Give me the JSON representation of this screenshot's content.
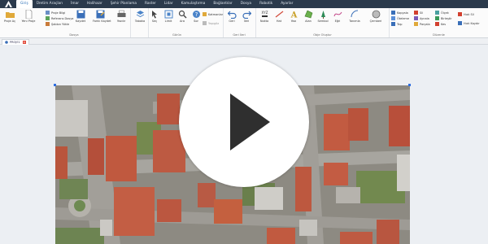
{
  "menu": {
    "items": [
      "Giriş",
      "Üretim Araçları",
      "İmar",
      "Halihazır",
      "Şehir Planlama",
      "Raster",
      "Lidar",
      "Kamulaştırma",
      "Bağlantılar",
      "Dosya",
      "Robotik",
      "Ayarlar"
    ],
    "active": "Giriş"
  },
  "ribbon": {
    "groups": {
      "dosya": "Dosya",
      "gorun": "Görün",
      "geri_ileri": "Geri İleri",
      "obje_olustur": "Obje Oluştur",
      "duzenle": "Düzenle"
    },
    "dosya": {
      "proje_ac": "Proje Aç",
      "yeni_proje": "Yeni Proje",
      "proje_bilgi": "Proje Bilgi",
      "referans_dosya": "Referans Dosya",
      "sablon_yukle": "Şablon Yükle",
      "kaydet": "Kaydet",
      "farkli_kaydet": "Farklı Kaydet",
      "yazdir": "Yazdır"
    },
    "gorun": {
      "tabaka": "Tabaka",
      "sec": "Seç",
      "limit": "Limit",
      "ara": "Ara",
      "sor": "Sor",
      "katmanlar": "Katmanlar",
      "yapigozle": "Yapıgöz"
    },
    "geri_ileri": {
      "geri": "Geri",
      "ileri": "İleri"
    },
    "obje": {
      "nokta": "Nokta",
      "hat": "Hat",
      "yazi": "Yazı",
      "alan": "Alan",
      "sembol": "Sembol",
      "egri": "Eğri",
      "tanimla": "Tanımla",
      "cemberi": "Çemberi"
    },
    "duzenle": {
      "kopyala": "Kopyala",
      "oteleme": "Öteleme",
      "tasi": "Taşı",
      "sil": "Sil",
      "aynala": "Aynala",
      "parcala": "Parçala",
      "olcek": "Ölçek",
      "birlestir": "Birleştir",
      "kes": "Kes",
      "hizli_sil": "Hızlı Sil",
      "hizli_kaydir": "Hızlı Kaydır"
    }
  },
  "document_tab": {
    "label": "PROJE1",
    "close": "x"
  },
  "colors": {
    "menubar": "#2b3a4c",
    "accent": "#2b6fb8",
    "handle": "#2f6ee0",
    "close": "#e04a3a"
  }
}
